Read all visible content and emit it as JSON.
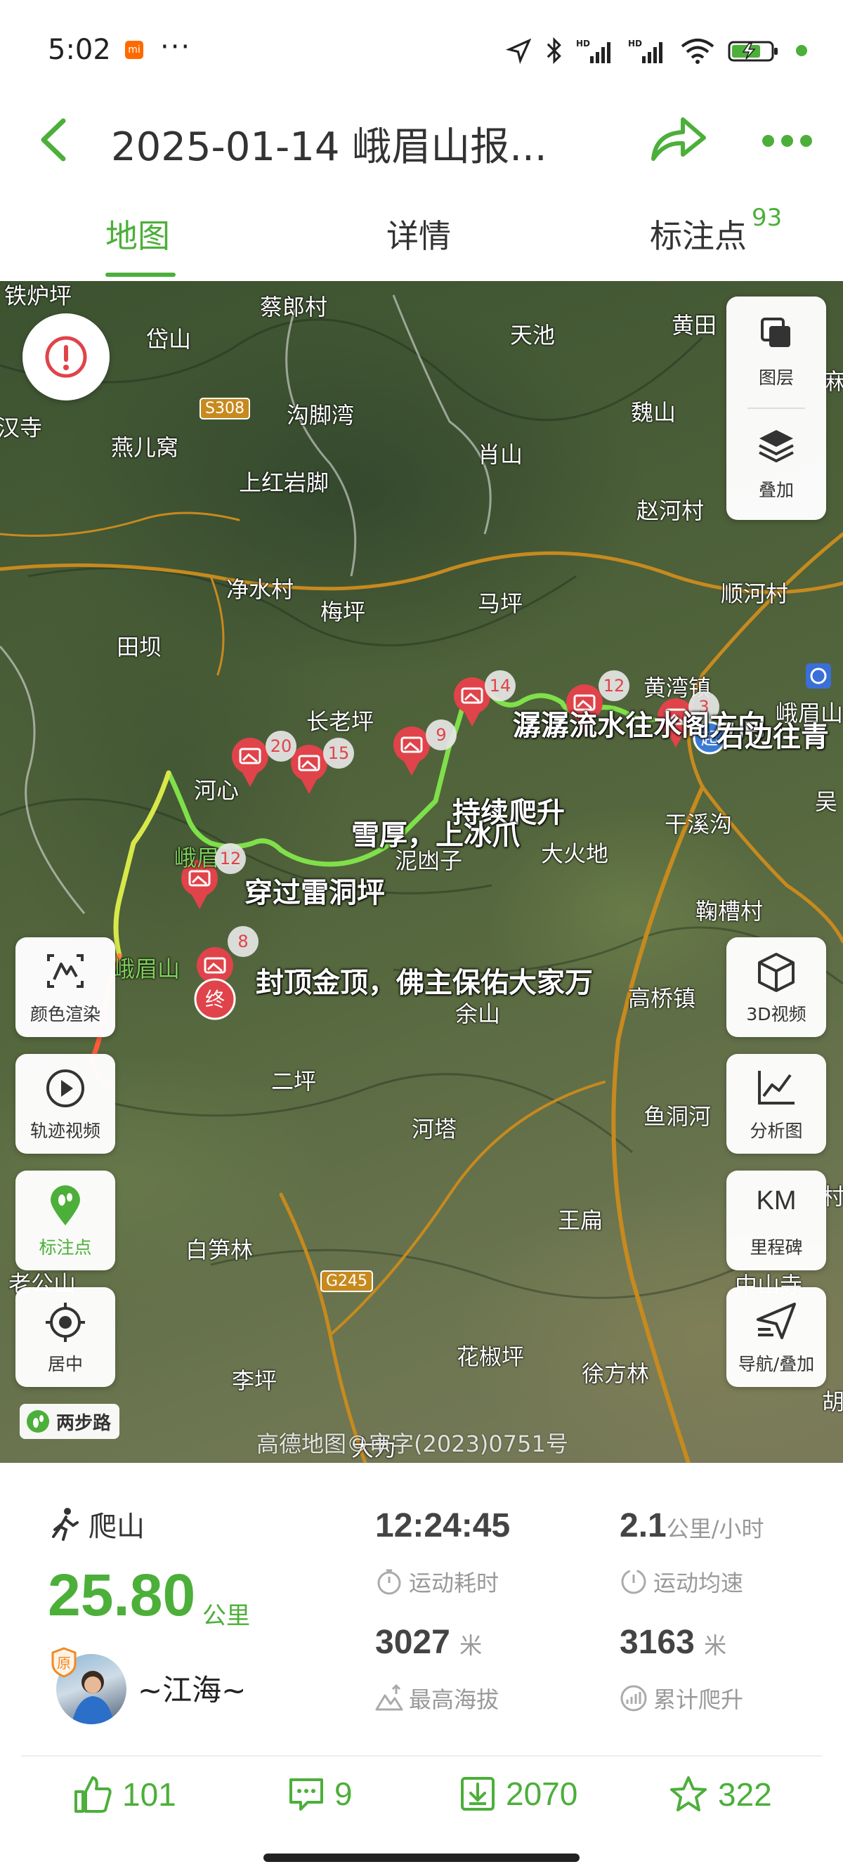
{
  "status_bar": {
    "time": "5:02",
    "dots": "···",
    "icons": [
      "xiaomi-notification-icon",
      "location-icon",
      "bluetooth-icon",
      "hd-signal-icon",
      "hd-signal-icon",
      "wifi-icon",
      "battery-charging-icon"
    ]
  },
  "header": {
    "title": "2025-01-14 峨眉山报...",
    "back_icon": "chevron-left-icon",
    "share_icon": "share-arrow-icon",
    "more_icon": "more-dots-icon",
    "accent_color": "#4caf3a"
  },
  "tabs": [
    {
      "label": "地图",
      "active": true
    },
    {
      "label": "详情",
      "active": false
    },
    {
      "label": "标注点",
      "active": false,
      "badge": "93"
    }
  ],
  "map": {
    "places": [
      {
        "name": "铁炉坪"
      },
      {
        "name": "蔡郎村"
      },
      {
        "name": "岱山"
      },
      {
        "name": "天池"
      },
      {
        "name": "黄田"
      },
      {
        "name": "汉寺"
      },
      {
        "name": "沟脚湾"
      },
      {
        "name": "魏山"
      },
      {
        "name": "燕儿窝"
      },
      {
        "name": "肖山"
      },
      {
        "name": "上红岩脚"
      },
      {
        "name": "赵河村"
      },
      {
        "name": "净水村"
      },
      {
        "name": "梅坪"
      },
      {
        "name": "马坪"
      },
      {
        "name": "顺河村"
      },
      {
        "name": "田坝"
      },
      {
        "name": "黄湾镇"
      },
      {
        "name": "长老坪"
      },
      {
        "name": "峨眉山"
      },
      {
        "name": "河心"
      },
      {
        "name": "干溪沟"
      },
      {
        "name": "吴"
      },
      {
        "name": "泥凼子"
      },
      {
        "name": "大火地"
      },
      {
        "name": "峨眉山"
      },
      {
        "name": "鞠槽村"
      },
      {
        "name": "峨眉山"
      },
      {
        "name": "高桥镇"
      },
      {
        "name": "余山"
      },
      {
        "name": "二坪"
      },
      {
        "name": "河塔"
      },
      {
        "name": "鱼洞河"
      },
      {
        "name": "王扁"
      },
      {
        "name": "白笋林"
      },
      {
        "name": "老公山"
      },
      {
        "name": "中山寺"
      },
      {
        "name": "花椒坪"
      },
      {
        "name": "徐方林"
      },
      {
        "name": "李坪"
      },
      {
        "name": "胡"
      },
      {
        "name": "大为"
      },
      {
        "name": "麻"
      },
      {
        "name": "村"
      }
    ],
    "road_labels": [
      "S308",
      "G245"
    ],
    "notes": [
      "潺潺流水往水阁方向",
      "右边往青",
      "持续爬升",
      "雪厚，上冰爪",
      "穿过雷洞坪",
      "封顶金顶，佛主保佑大家万"
    ],
    "photo_counts": [
      "14",
      "12",
      "3",
      "9",
      "15",
      "20",
      "12",
      "8"
    ],
    "start_marker": "起",
    "end_marker": "终",
    "controls": {
      "layers": "图层",
      "overlay": "叠加",
      "color_render": "颜色渲染",
      "track_video": "轨迹视频",
      "markers": "标注点",
      "center": "居中",
      "video_3d": "3D视频",
      "analysis": "分析图",
      "milestone_icon_text": "KM",
      "milestone": "里程碑",
      "navigation": "导航/叠加"
    },
    "brand": "两步路",
    "copyright": "高德地图©审字(2023)0751号",
    "colors": {
      "track_green": "#7fe04a",
      "track_yellow": "#d8e84a",
      "track_red": "#ff5a3a",
      "pin_red": "#e0434a"
    }
  },
  "stats": {
    "sport": "爬山",
    "distance": "25.80",
    "distance_unit": "公里",
    "username": "~江海~",
    "original_badge": "原",
    "duration": {
      "value": "12:24:45",
      "label": "运动耗时"
    },
    "avg_speed": {
      "value": "2.1",
      "unit": "公里/小时",
      "label": "运动均速"
    },
    "max_alt": {
      "value": "3027",
      "unit": "米",
      "label": "最高海拔"
    },
    "total_climb": {
      "value": "3163",
      "unit": "米",
      "label": "累计爬升"
    }
  },
  "actions": {
    "likes": "101",
    "comments": "9",
    "downloads": "2070",
    "favorites": "322"
  }
}
